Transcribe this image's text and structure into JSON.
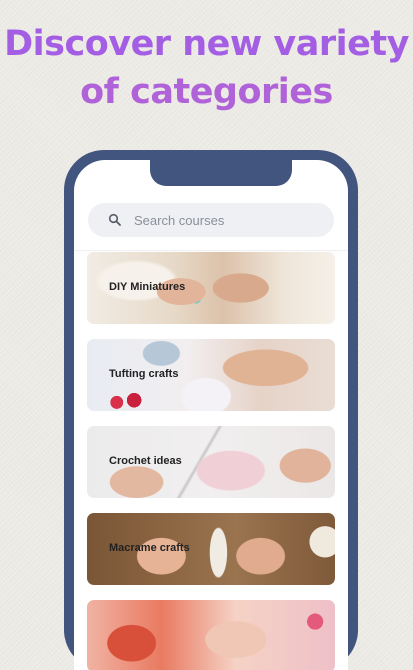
{
  "headline": {
    "line1": "Discover new variety",
    "line2": "of categories"
  },
  "search": {
    "placeholder": "Search courses",
    "icon": "search-icon"
  },
  "categories": [
    {
      "label": "DIY Miniatures"
    },
    {
      "label": "Tufting crafts"
    },
    {
      "label": "Crochet ideas"
    },
    {
      "label": "Macrame crafts"
    },
    {
      "label": ""
    }
  ],
  "colors": {
    "headline": "#a45be0",
    "phone_frame": "#42557e",
    "search_background": "#eff0f4"
  }
}
